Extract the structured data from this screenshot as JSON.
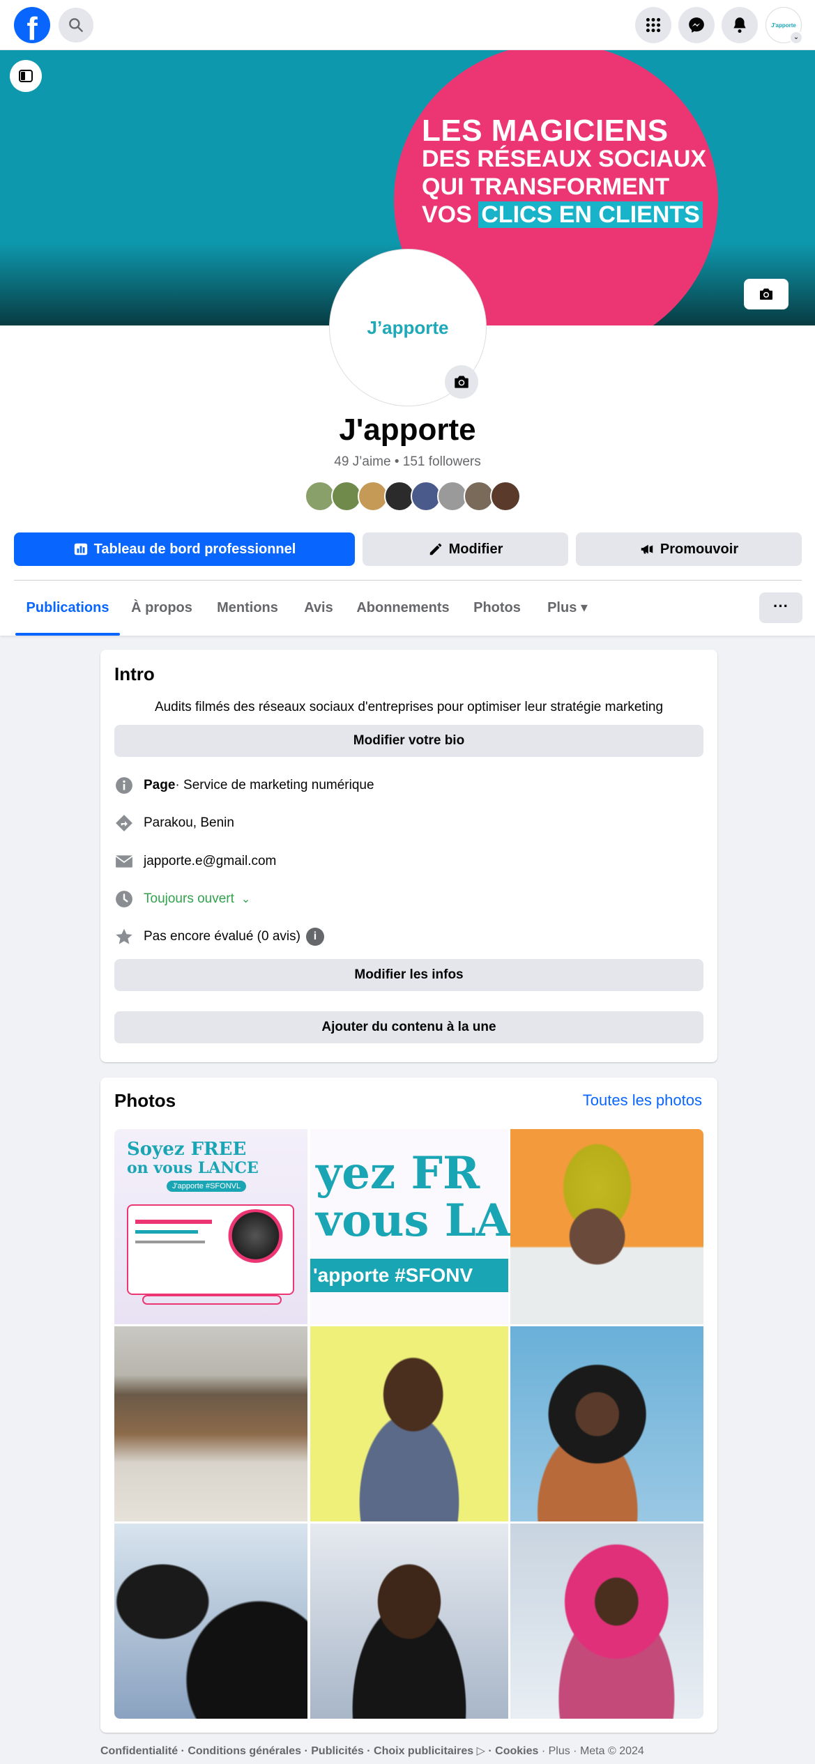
{
  "topbar": {
    "logo_letter": "f",
    "icons": [
      "search-icon",
      "apps-grid-icon",
      "messenger-icon",
      "bell-icon"
    ],
    "avatar_text": "J'apporte"
  },
  "cover": {
    "line1": "LES MAGICIENS",
    "line2": "DES RÉSEAUX SOCIAUX",
    "line3": "QUI TRANSFORMENT",
    "line4_a": "VOS ",
    "line4_b": "CLICS EN CLIENTS",
    "colors": {
      "teal": "#0e98ad",
      "pink": "#ec3673"
    }
  },
  "profile": {
    "logo_text": "J’apporte",
    "name": "J'apporte",
    "stats": "49 J’aime • 151 followers",
    "friend_colors": [
      "#8aa06a",
      "#6f8a4a",
      "#c59a56",
      "#2b2b2b",
      "#4a5a8a",
      "#9a9a9a",
      "#7a6a5a",
      "#5a3a2a"
    ]
  },
  "actions": {
    "dashboard": "Tableau de bord professionnel",
    "edit": "Modifier",
    "promote": "Promouvoir"
  },
  "tabs": {
    "items": [
      "Publications",
      "À propos",
      "Mentions",
      "Avis",
      "Abonnements",
      "Photos",
      "Plus ▾"
    ],
    "active": "Publications",
    "more": "···"
  },
  "intro": {
    "title": "Intro",
    "bio": "Audits filmés des réseaux sociaux d'entreprises pour optimiser leur stratégie marketing",
    "edit_bio": "Modifier votre bio",
    "page_label": "Page",
    "page_category": " · Service de marketing numérique",
    "location": "Parakou, Benin",
    "email": "japporte.e@gmail.com",
    "hours": "Toujours ouvert",
    "hours_caret": "⌄",
    "rating": "Pas encore évalué (0 avis)",
    "edit_info": "Modifier les infos",
    "featured": "Ajouter du contenu à la une"
  },
  "photos": {
    "title": "Photos",
    "see_all": "Toutes les photos",
    "poster_line1": "Soyez FREE",
    "poster_line2": "on vous LANCE",
    "poster_tag": "J'apporte   #SFONVL",
    "poster_big1": "yez FR",
    "poster_big2": "vous LA",
    "poster_big3": "'apporte   #SFONV"
  },
  "footer": {
    "links": "Confidentialité · Conditions générales · Publicités · Choix publicitaires ▷ · Cookies",
    "tail": " · Plus · Meta © 2024"
  }
}
